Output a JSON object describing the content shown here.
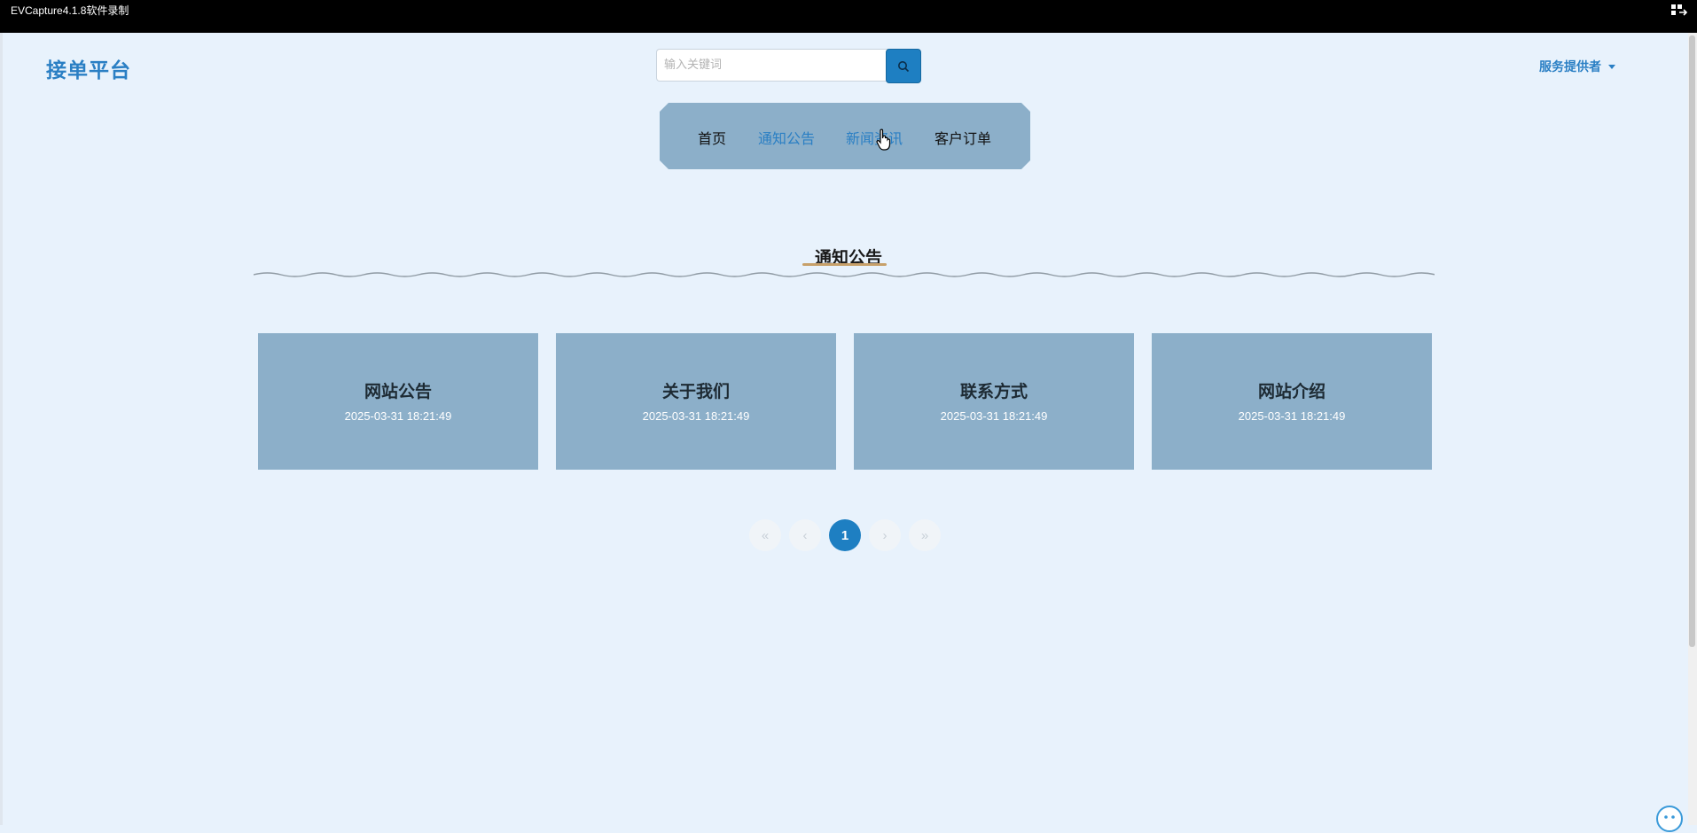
{
  "recorder": {
    "title": "EVCapture4.1.8软件录制"
  },
  "header": {
    "logo": "接单平台",
    "search": {
      "placeholder": "输入关键词",
      "value": ""
    },
    "user_menu_label": "服务提供者"
  },
  "nav": {
    "items": [
      {
        "label": "首页",
        "active": false
      },
      {
        "label": "通知公告",
        "active": true
      },
      {
        "label": "新闻资讯",
        "active": true
      },
      {
        "label": "客户订单",
        "active": false
      }
    ]
  },
  "section": {
    "title": "通知公告"
  },
  "cards": [
    {
      "title": "网站公告",
      "date": "2025-03-31 18:21:49"
    },
    {
      "title": "关于我们",
      "date": "2025-03-31 18:21:49"
    },
    {
      "title": "联系方式",
      "date": "2025-03-31 18:21:49"
    },
    {
      "title": "网站介绍",
      "date": "2025-03-31 18:21:49"
    }
  ],
  "pagination": {
    "first": "«",
    "prev": "‹",
    "current": "1",
    "next": "›",
    "last": "»"
  },
  "colors": {
    "accent": "#1e7fc2",
    "card_bg": "#8cafc9",
    "page_bg": "#e8f2fc"
  }
}
